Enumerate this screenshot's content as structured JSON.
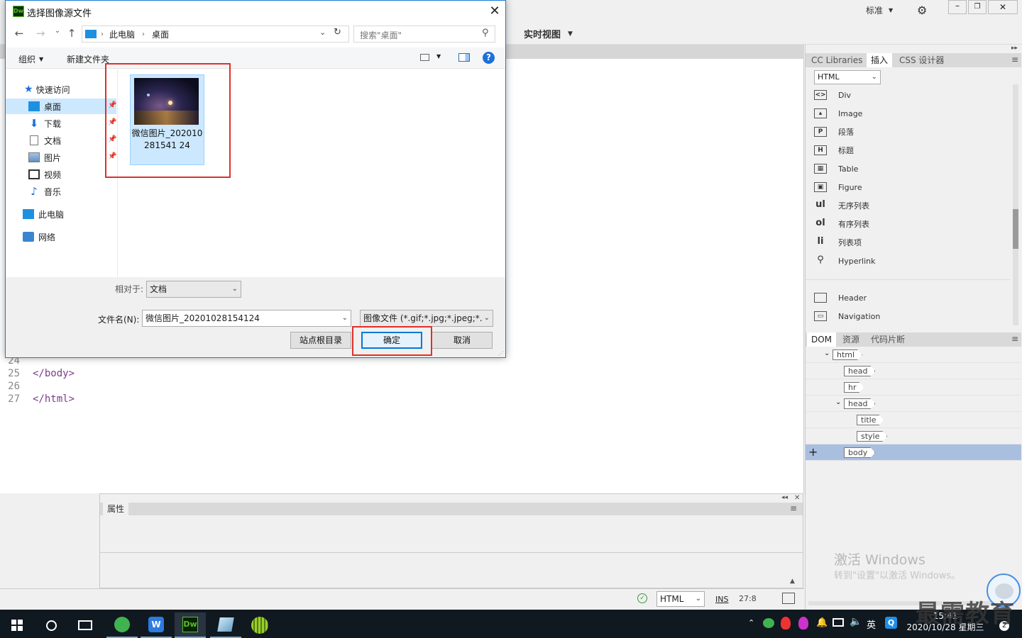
{
  "app": {
    "workspace_label": "标准",
    "view_label": "实时视图",
    "code_lines": [
      {
        "num": "24",
        "text": ""
      },
      {
        "num": "25",
        "text": "</body>"
      },
      {
        "num": "26",
        "text": ""
      },
      {
        "num": "27",
        "text": "</html>"
      }
    ],
    "properties_tab": "属性",
    "status": {
      "language": "HTML",
      "mode": "INS",
      "position": "27:8"
    }
  },
  "right_panel": {
    "tabs": [
      "CC Libraries",
      "插入",
      "CSS 设计器"
    ],
    "insert_category": "HTML",
    "insert_items": [
      {
        "icon": "div-icon",
        "label": "Div"
      },
      {
        "icon": "image-icon",
        "label": "Image"
      },
      {
        "icon": "paragraph-icon",
        "label": "段落"
      },
      {
        "icon": "heading-icon",
        "label": "标题"
      },
      {
        "icon": "table-icon",
        "label": "Table"
      },
      {
        "icon": "figure-icon",
        "label": "Figure"
      },
      {
        "icon": "ul-icon",
        "label": "无序列表",
        "glyph": "ul"
      },
      {
        "icon": "ol-icon",
        "label": "有序列表",
        "glyph": "ol"
      },
      {
        "icon": "li-icon",
        "label": "列表项",
        "glyph": "li"
      },
      {
        "icon": "hyperlink-icon",
        "label": "Hyperlink"
      },
      {
        "icon": "header-icon",
        "label": "Header"
      },
      {
        "icon": "navigation-icon",
        "label": "Navigation"
      }
    ],
    "dom_tabs": [
      "DOM",
      "资源",
      "代码片断"
    ],
    "dom_nodes": [
      {
        "tag": "html",
        "depth": 0,
        "expanded": true
      },
      {
        "tag": "head",
        "depth": 1
      },
      {
        "tag": "hr",
        "depth": 1
      },
      {
        "tag": "head",
        "depth": 1,
        "expanded": true
      },
      {
        "tag": "title",
        "depth": 2
      },
      {
        "tag": "style",
        "depth": 2
      },
      {
        "tag": "body",
        "depth": 1,
        "selected": true
      }
    ],
    "activation_title": "激活 Windows",
    "activation_sub": "转到\"设置\"以激活 Windows。"
  },
  "dialog": {
    "title": "选择图像源文件",
    "breadcrumb": [
      "此电脑",
      "桌面"
    ],
    "search_placeholder": "搜索\"桌面\"",
    "organize_label": "组织",
    "new_folder_label": "新建文件夹",
    "nav_quick_access": "快速访问",
    "nav_items": [
      {
        "icon": "desktop-icon",
        "label": "桌面",
        "selected": true
      },
      {
        "icon": "download-icon",
        "label": "下载"
      },
      {
        "icon": "document-icon",
        "label": "文档"
      },
      {
        "icon": "picture-icon",
        "label": "图片"
      },
      {
        "icon": "video-icon",
        "label": "视频"
      },
      {
        "icon": "music-icon",
        "label": "音乐"
      }
    ],
    "nav_this_pc": "此电脑",
    "nav_network": "网络",
    "file": {
      "name": "微信图片_20201028154124",
      "display_name": "微信图片_202010281541 24"
    },
    "relative_label": "相对于:",
    "relative_value": "文档",
    "filename_label": "文件名(N):",
    "filename_value": "微信图片_20201028154124",
    "filetype_value": "图像文件 (*.gif;*.jpg;*.jpeg;*.p",
    "site_root_button": "站点根目录",
    "ok_button": "确定",
    "cancel_button": "取消"
  },
  "taskbar": {
    "ime": "英",
    "clock_time": "15:41",
    "clock_date": "2020/10/28 星期三",
    "notification_count": "2"
  },
  "brand_watermark": "最需教育",
  "colors": {
    "highlight_red": "#e0302a",
    "selection_blue": "#cce8ff",
    "dw_green": "#5cbd2c",
    "accent_blue": "#0078d7"
  }
}
